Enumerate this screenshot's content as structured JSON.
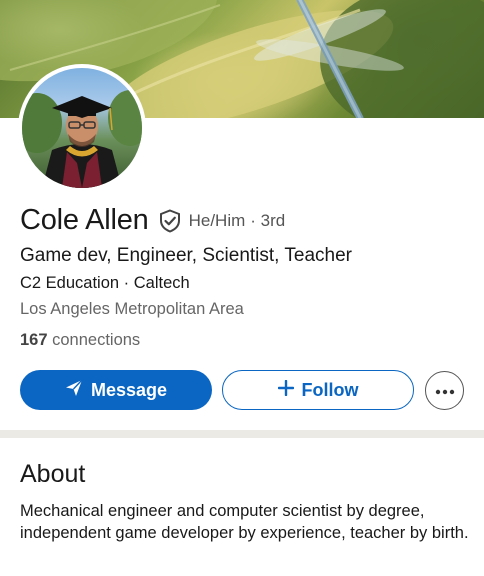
{
  "profile": {
    "name": "Cole Allen",
    "pronouns": "He/Him",
    "degree": "· 3rd",
    "headline": "Game dev, Engineer, Scientist,  Teacher",
    "organization": "C2 Education · Caltech",
    "location": "Los Angeles Metropolitan Area",
    "connections_count": "167",
    "connections_label": "connections"
  },
  "actions": {
    "message_label": "Message",
    "follow_label": "Follow"
  },
  "about": {
    "title": "About",
    "text": "Mechanical engineer and computer scientist by degree, independent game developer by experience, teacher by birth."
  },
  "icons": {
    "verify": "shield-check-icon",
    "message": "paper-plane-icon",
    "follow": "plus-icon",
    "more": "more-horizontal-icon"
  },
  "colors": {
    "accent": "#0a66c2",
    "text": "#191919",
    "muted": "#666666"
  }
}
